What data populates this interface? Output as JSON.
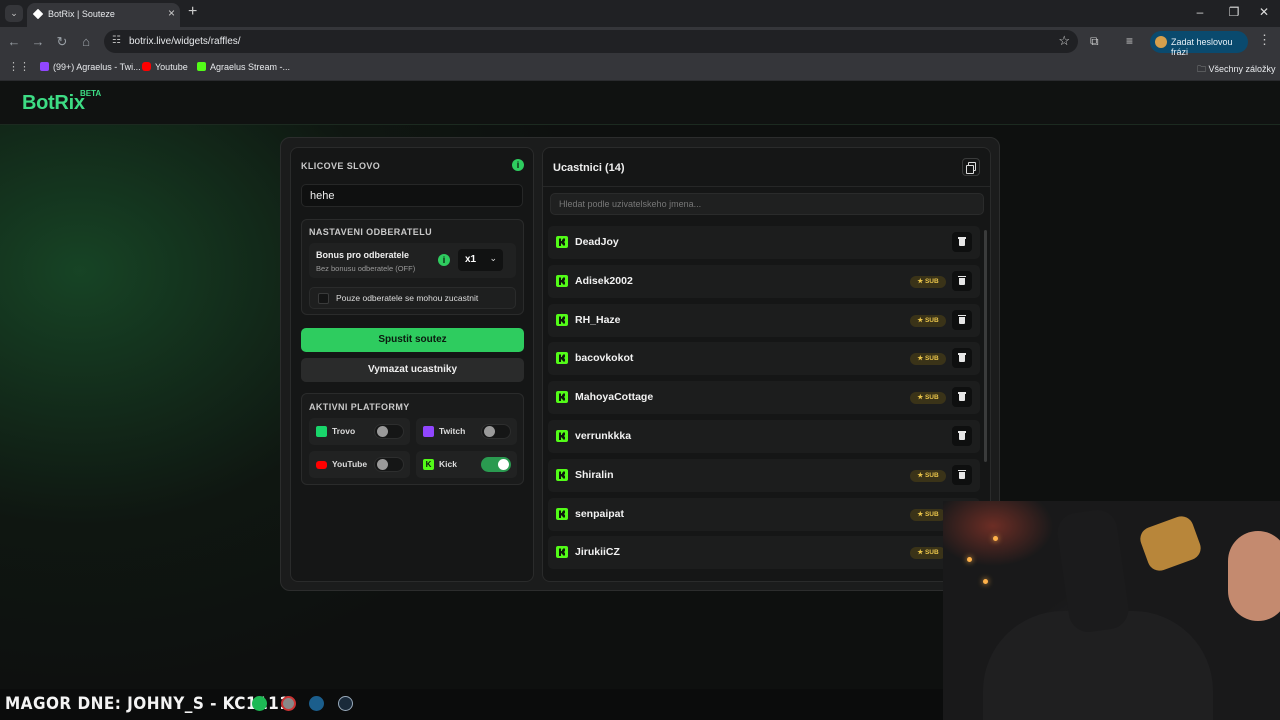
{
  "browser": {
    "tab_title": "BotRix | Souteze",
    "url": "botrix.live/widgets/raffles/",
    "profile_label": "Zadat heslovou frázi",
    "bookmarks": [
      {
        "label": "(99+) Agraelus - Twi...",
        "color": "#9146ff"
      },
      {
        "label": "Youtube",
        "color": "#ff0000"
      },
      {
        "label": "Agraelus Stream -...",
        "color": "#53fc18"
      }
    ],
    "all_bookmarks_label": "Všechny záložky"
  },
  "app": {
    "logo": "BotRix",
    "logo_badge": "BETA",
    "accent": "#2ecc5f"
  },
  "keyword": {
    "title": "KLICOVE SLOVO",
    "value": "hehe"
  },
  "subscriber_settings": {
    "title": "NASTAVENI ODBERATELU",
    "bonus_title": "Bonus pro odberatele",
    "bonus_subtitle": "Bez bonusu odberatele (OFF)",
    "multiplier": "x1",
    "only_subs_label": "Pouze odberatele se mohou zucastnit",
    "only_subs_checked": false
  },
  "actions": {
    "start_label": "Spustit soutez",
    "clear_label": "Vymazat ucastniky"
  },
  "platforms": {
    "title": "AKTIVNI PLATFORMY",
    "items": [
      {
        "name": "Trovo",
        "enabled": false,
        "color": "#19d66b"
      },
      {
        "name": "Twitch",
        "enabled": false,
        "color": "#9146ff"
      },
      {
        "name": "YouTube",
        "enabled": false,
        "color": "#ff0000"
      },
      {
        "name": "Kick",
        "enabled": true,
        "color": "#53fc18"
      }
    ]
  },
  "participants": {
    "title": "Ucastnici (14)",
    "search_placeholder": "Hledat podle uzivatelskeho jmena...",
    "sub_badge": "SUB",
    "rows": [
      {
        "name": "DeadJoy",
        "sub": false
      },
      {
        "name": "Adisek2002",
        "sub": true
      },
      {
        "name": "RH_Haze",
        "sub": true
      },
      {
        "name": "bacovkokot",
        "sub": true
      },
      {
        "name": "MahoyaCottage",
        "sub": true
      },
      {
        "name": "verrunkkka",
        "sub": false
      },
      {
        "name": "Shiralin",
        "sub": true
      },
      {
        "name": "senpaipat",
        "sub": true
      },
      {
        "name": "JirukiiCZ",
        "sub": true
      }
    ]
  },
  "overlay": {
    "ticker": "MAGOR DNE: JOHNY_S - KC1111"
  }
}
